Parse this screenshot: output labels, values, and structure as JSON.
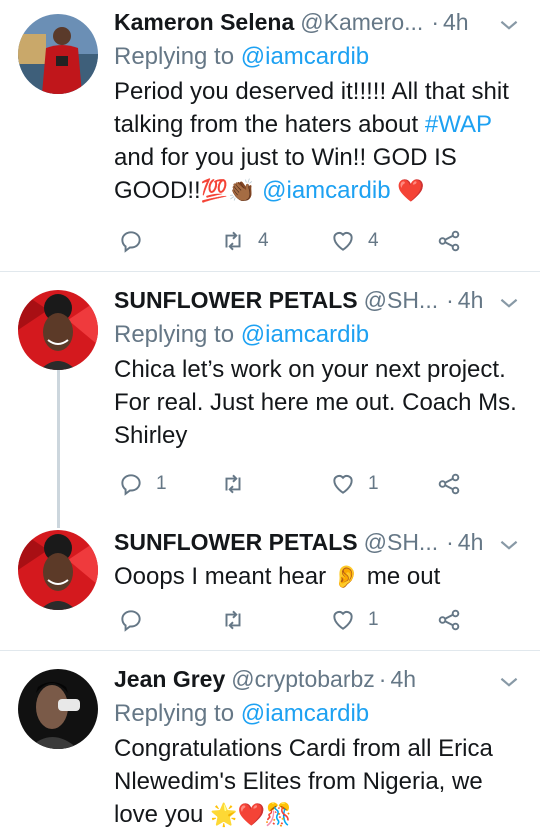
{
  "tweets": [
    {
      "name": "Kameron Selena",
      "handle": "@Kamero...",
      "time": "4h",
      "reply_label": "Replying to",
      "reply_to": "@iamcardib",
      "text_1": "Period you deserved it!!!!! All that shit talking from the haters about ",
      "hashtag": "#WAP",
      "text_2": " and for you just to Win!! GOD IS GOOD!!",
      "emojis_1": "💯👏🏾",
      "mention": "@iamcardib",
      "emojis_2": "❤️",
      "replies": "",
      "retweets": "4",
      "likes": "4"
    },
    {
      "name": "SUNFLOWER PETALS",
      "handle": "@SH...",
      "time": "4h",
      "reply_label": "Replying to",
      "reply_to": "@iamcardib",
      "text": "Chica let’s work on your next project. For real. Just here me out. Coach Ms. Shirley",
      "replies": "1",
      "retweets": "",
      "likes": "1"
    },
    {
      "name": "SUNFLOWER PETALS",
      "handle": "@SH...",
      "time": "4h",
      "text_1": "Ooops I meant hear ",
      "emoji": "👂",
      "text_2": " me out",
      "replies": "",
      "retweets": "",
      "likes": "1"
    },
    {
      "name": "Jean Grey",
      "handle": "@cryptobarbz",
      "time": "4h",
      "reply_label": "Replying to",
      "reply_to": "@iamcardib",
      "text_1": "Congratulations Cardi from all Erica Nlewedim's Elites from Nigeria, we love you ",
      "emojis": "🌟❤️🎊"
    }
  ],
  "separator": "·",
  "colors": {
    "link": "#1da1f2",
    "secondary": "#657786",
    "divider": "#e1e8ed",
    "thread_line": "#ccd6dd",
    "heart": "#e0245e"
  },
  "icons": [
    "chevron-down-icon",
    "reply-icon",
    "retweet-icon",
    "like-icon",
    "share-icon"
  ]
}
